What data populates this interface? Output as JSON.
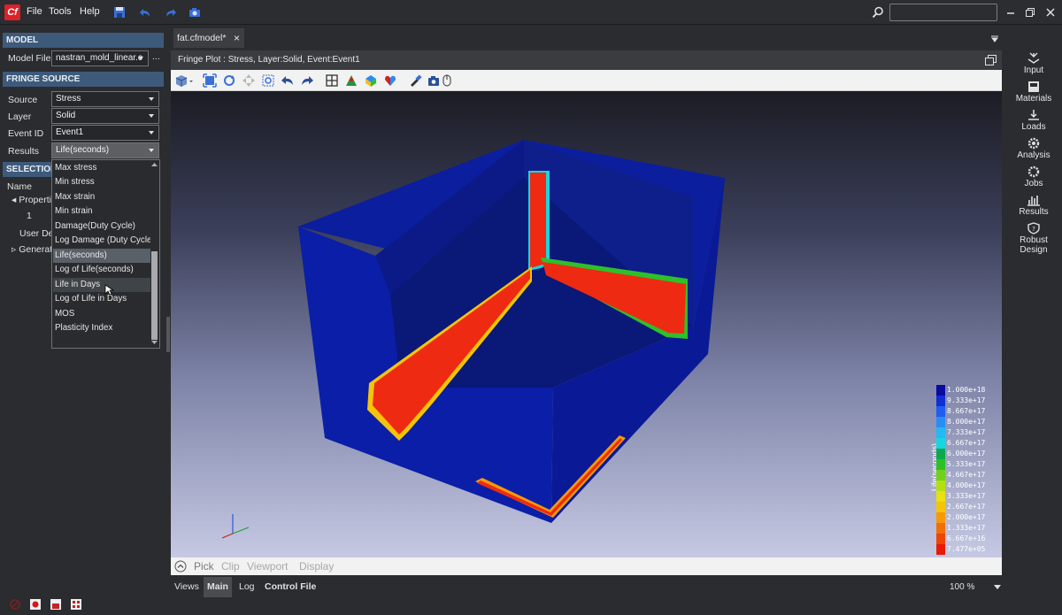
{
  "app": {
    "logo_text": "Cf"
  },
  "menu": [
    "File",
    "Tools",
    "Help"
  ],
  "search": {
    "placeholder": ""
  },
  "model": {
    "header": "MODEL",
    "file_label": "Model File",
    "file_value": "nastran_mold_linear.c",
    "browse_label": "..."
  },
  "fringe": {
    "header": "FRINGE SOURCE",
    "source_label": "Source",
    "source_value": "Stress",
    "layer_label": "Layer",
    "layer_value": "Solid",
    "event_label": "Event ID",
    "event_value": "Event1",
    "results_label": "Results",
    "results_value": "Life(seconds)",
    "results_options": [
      "Max stress",
      "Min stress",
      "Max strain",
      "Min strain",
      "Damage(Duty Cycle)",
      "Log Damage (Duty Cycle)",
      "Life(seconds)",
      "Log of Life(seconds)",
      "Life in Days",
      "Log of Life in Days",
      "MOS",
      "Plasticity Index"
    ],
    "selected_option": "Life(seconds)",
    "hovered_option": "Life in Days"
  },
  "selection": {
    "header": "SELECTION",
    "name_col": "Name",
    "tree": [
      "Properties",
      "1",
      "User Def",
      "Generati"
    ]
  },
  "tabs": {
    "doc_tab": "fat.cfmodel*"
  },
  "view": {
    "title": "Fringe Plot : Stress, Layer:Solid, Event:Event1"
  },
  "legend": {
    "title": "Life(seconds)",
    "labels": [
      "1.000e+18",
      "9.333e+17",
      "8.667e+17",
      "8.000e+17",
      "7.333e+17",
      "6.667e+17",
      "6.000e+17",
      "5.333e+17",
      "4.667e+17",
      "4.000e+17",
      "3.333e+17",
      "2.667e+17",
      "2.000e+17",
      "1.333e+17",
      "6.667e+16",
      "7.477e+05"
    ],
    "colors": [
      "#0a0aa0",
      "#0f2fd4",
      "#1f5cf0",
      "#2a8cf5",
      "#22b9f5",
      "#16d6e0",
      "#0fa84a",
      "#2ec02a",
      "#6fd21a",
      "#b5e010",
      "#e8e010",
      "#f5c408",
      "#f59a06",
      "#f07006",
      "#ee4406",
      "#e81a06"
    ]
  },
  "bottom_controls": [
    "Pick",
    "Clip",
    "Viewport",
    "Display"
  ],
  "status_tabs": [
    "Views",
    "Main",
    "Log",
    "Control File"
  ],
  "active_status_tab": "Main",
  "zoom": "100 %",
  "right_nav": [
    "Input",
    "Materials",
    "Loads",
    "Analysis",
    "Jobs",
    "Results",
    "Robust Design"
  ],
  "colors": {
    "accent": "#3d5a7a",
    "fringe_red": "#ee2a12",
    "fringe_blue": "#0b1e9e"
  }
}
